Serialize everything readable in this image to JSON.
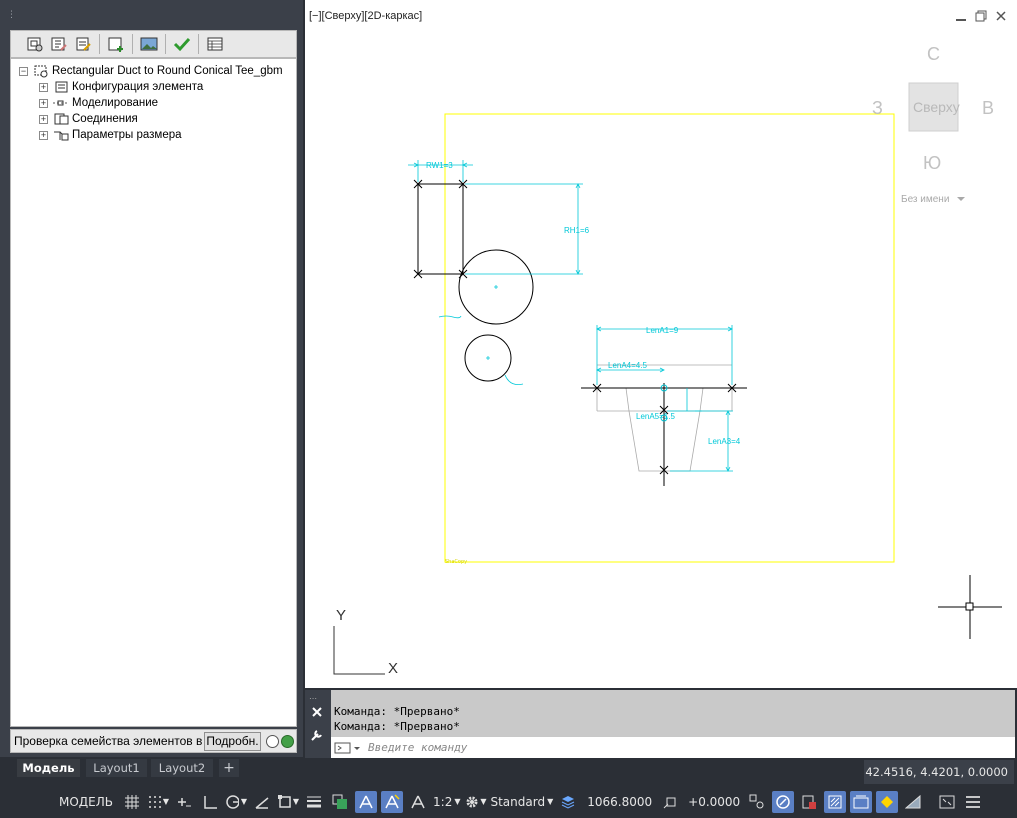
{
  "toolbar": {
    "buttons": [
      "family-properties-icon",
      "edit-family-icon",
      "save-icon",
      "add-element-icon",
      "image-icon",
      "check-icon",
      "table-icon"
    ]
  },
  "tree": {
    "root": "Rectangular Duct to Round Conical Tee_gbm",
    "items": [
      {
        "label": "Конфигурация элемента",
        "icon": "config-icon"
      },
      {
        "label": "Моделирование",
        "icon": "modeling-icon"
      },
      {
        "label": "Соединения",
        "icon": "connections-icon"
      },
      {
        "label": "Параметры размера",
        "icon": "size-params-icon"
      }
    ]
  },
  "status_row": {
    "text": "Проверка семейства элементов в",
    "details_label": "Подробн."
  },
  "viewport": {
    "label": "[−][Сверху][2D-каркас]",
    "viewcube": {
      "north": "С",
      "south": "Ю",
      "west": "З",
      "east": "В",
      "face": "Сверху",
      "ucs": "Без имени"
    },
    "dims": {
      "rw1": "RW1=3",
      "rh1": "RH1=6",
      "lena1": "LenA1=9",
      "lena4": "LenA4=4.5",
      "lena5": "LenA5=1.5",
      "lena3": "LenA3=4"
    },
    "axis_x": "X",
    "axis_y": "Y"
  },
  "command": {
    "history": [
      "Команда:  *Прервано*",
      "Команда:  *Прервано*"
    ],
    "placeholder": "Введите команду"
  },
  "tabs": [
    "Модель",
    "Layout1",
    "Layout2",
    "+"
  ],
  "coords": "42.4516, 4.4201, 0.0000",
  "status_bar": {
    "model": "МОДЕЛЬ",
    "scale": "1:2",
    "style": "Standard",
    "elevation": "1066.8000",
    "offset": "+0.0000"
  },
  "colors": {
    "cyan": "#00c8d8",
    "yellow": "#ffff00",
    "accent": "#5a7fc4",
    "green": "#43a047"
  }
}
